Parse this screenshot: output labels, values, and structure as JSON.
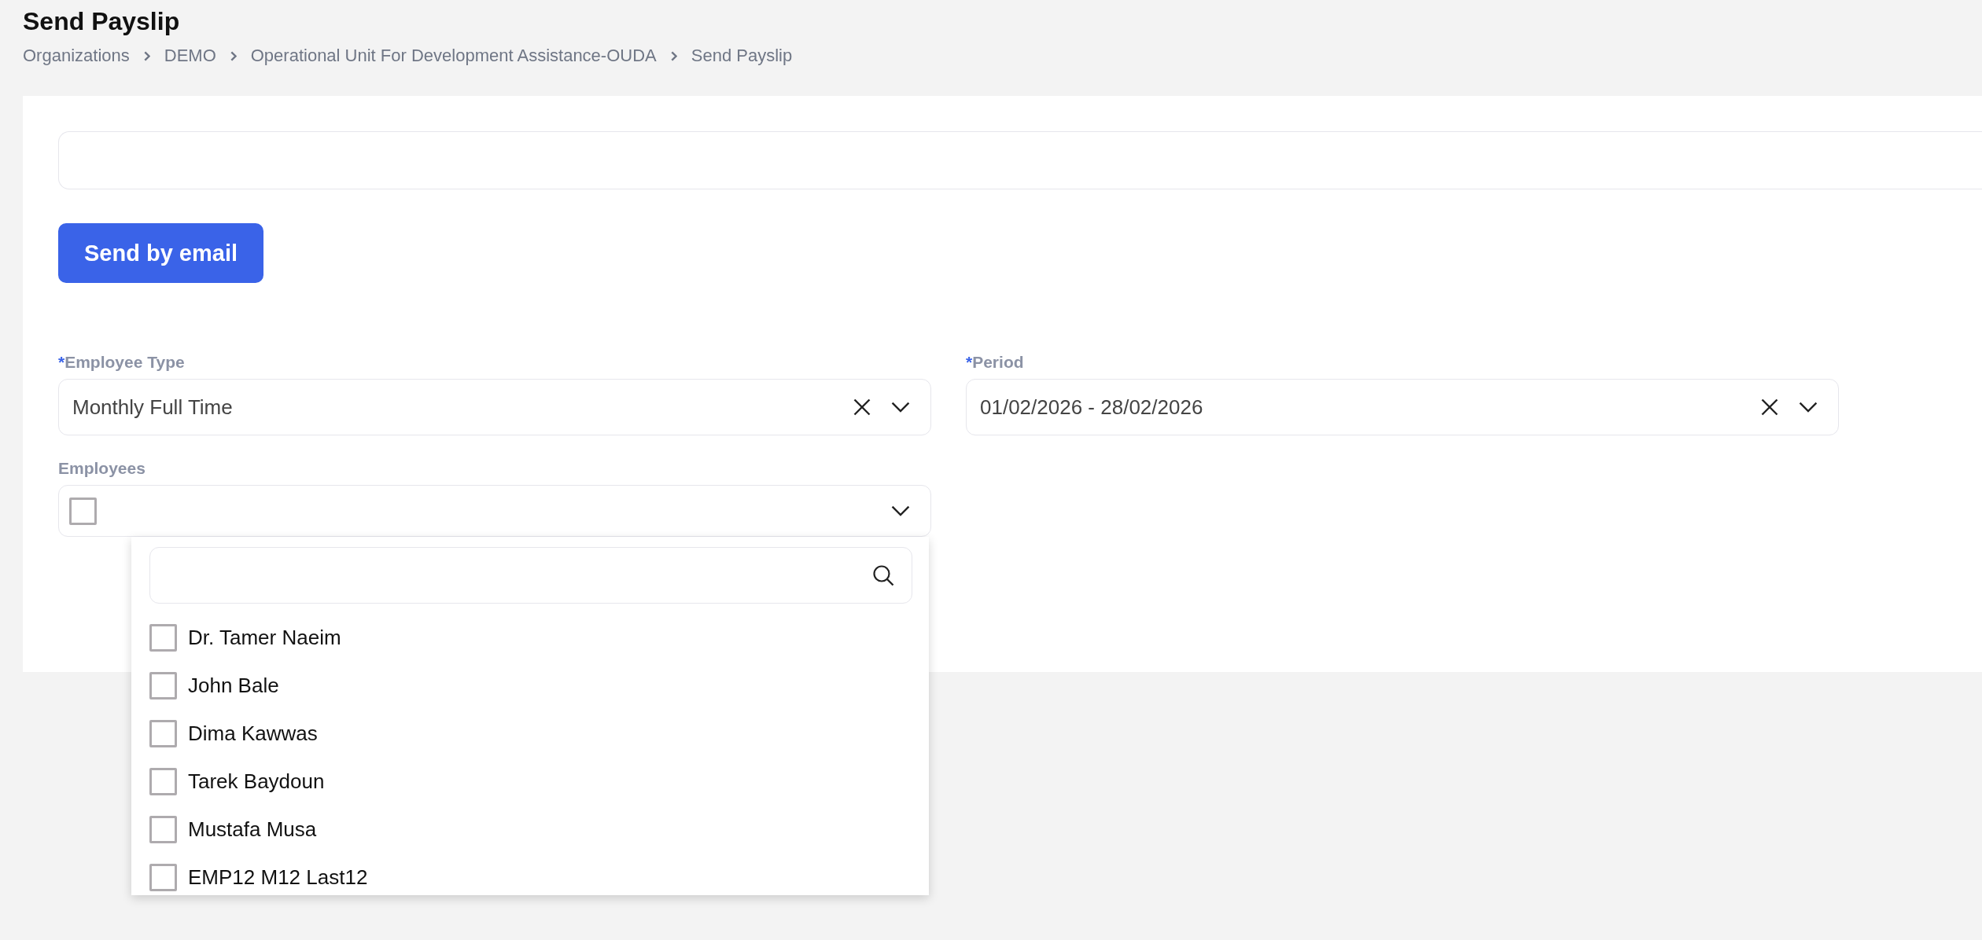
{
  "page": {
    "title": "Send Payslip"
  },
  "breadcrumb": [
    {
      "label": "Organizations"
    },
    {
      "label": "DEMO"
    },
    {
      "label": "Operational Unit For Development Assistance-OUDA"
    },
    {
      "label": "Send Payslip"
    }
  ],
  "form": {
    "send_button": {
      "label": "Send by email"
    },
    "fields": [
      {
        "kind": "select",
        "required_mark": "*",
        "label": "Employee Type",
        "value": "Monthly Full Time",
        "clearable": true
      },
      {
        "kind": "select",
        "required_mark": "*",
        "label": "Period",
        "value": "01/02/2026 - 28/02/2026",
        "clearable": true
      },
      {
        "kind": "multiselect",
        "label": "Employees",
        "select_all_checked": false,
        "expanded": true,
        "options": [
          {
            "name": "Dr. Tamer Naeim",
            "checked": false
          },
          {
            "name": "John Bale",
            "checked": false
          },
          {
            "name": "Dima Kawwas",
            "checked": false
          },
          {
            "name": "Tarek Baydoun",
            "checked": false
          },
          {
            "name": "Mustafa Musa",
            "checked": false
          },
          {
            "name": "EMP12 M12 Last12",
            "checked": false
          }
        ]
      }
    ]
  }
}
